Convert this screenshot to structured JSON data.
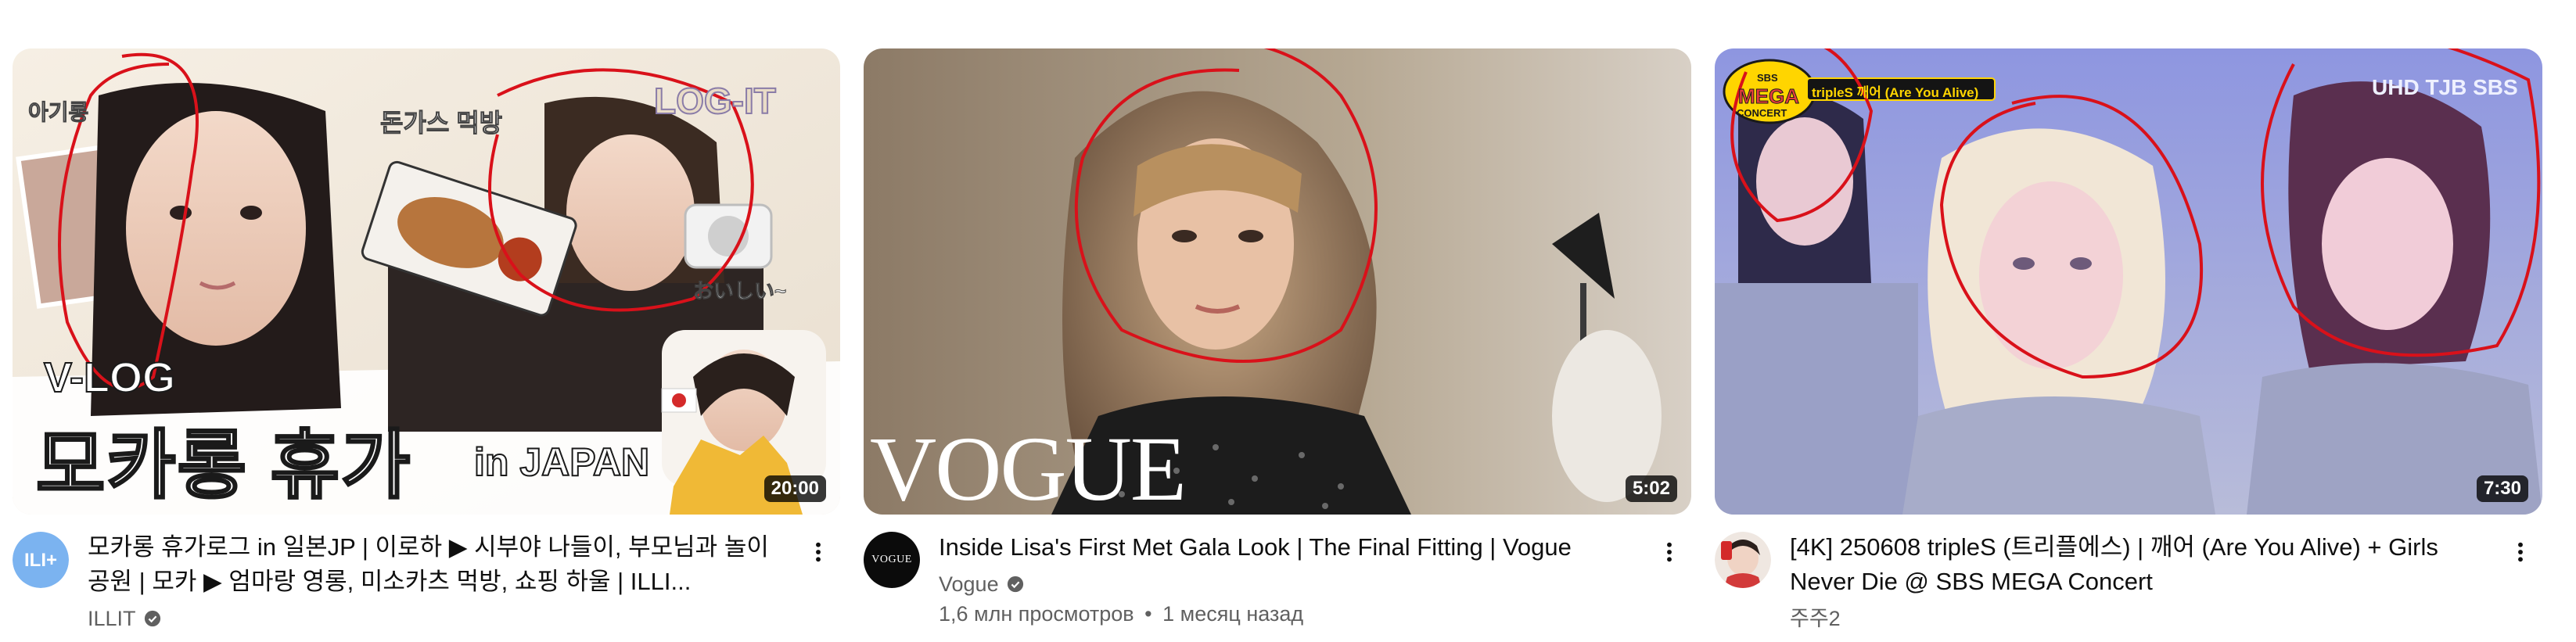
{
  "videos": [
    {
      "title": "모카롱 휴가로그 in 일본JP | 이로하 ▶ 시부야 나들이, 부모님과 놀이공원 | 모카 ▶ 엄마랑 영롱, 미소카츠 먹방, 쇼핑 하울 | ILLI...",
      "channel": "ILLIT",
      "verified": true,
      "duration": "20:00",
      "avatar_icon": "illit-logo-icon",
      "thumb_text": {
        "vlog": "V-LOG",
        "main_title": "모카롱 휴가",
        "in_japan": "in JAPAN",
        "ahgi": "아기롱",
        "tonkatsu": "돈가스 먹방",
        "logo": "LOG-IT",
        "oishii": "おいしい~"
      }
    },
    {
      "title": "Inside Lisa's First Met Gala Look | The Final Fitting | Vogue",
      "channel": "Vogue",
      "verified": true,
      "views": "1,6 млн просмотров",
      "age": "1 месяц назад",
      "separator": "•",
      "duration": "5:02",
      "avatar_text": "VOGUE",
      "thumb_text": {
        "brand": "VOGUE"
      }
    },
    {
      "title": "[4K] 250608 tripleS (트리플에스) | 깨어 (Are You Alive) + Girls Never Die @ SBS MEGA Concert",
      "channel": "주주2",
      "duration": "7:30",
      "avatar_icon": "channel-avatar-icon",
      "thumb_text": {
        "caption": "tripleS 깨어 (Are You Alive)",
        "broadcaster": "UHD TJB SBS",
        "badge_top": "SBS",
        "badge_main": "MEGA",
        "badge_bottom": "CONCERT"
      }
    }
  ],
  "colors": {
    "text_primary": "#0f0f0f",
    "text_secondary": "#606060",
    "annotation_red": "#d9111a",
    "illit_avatar": "#7bb3f0"
  }
}
